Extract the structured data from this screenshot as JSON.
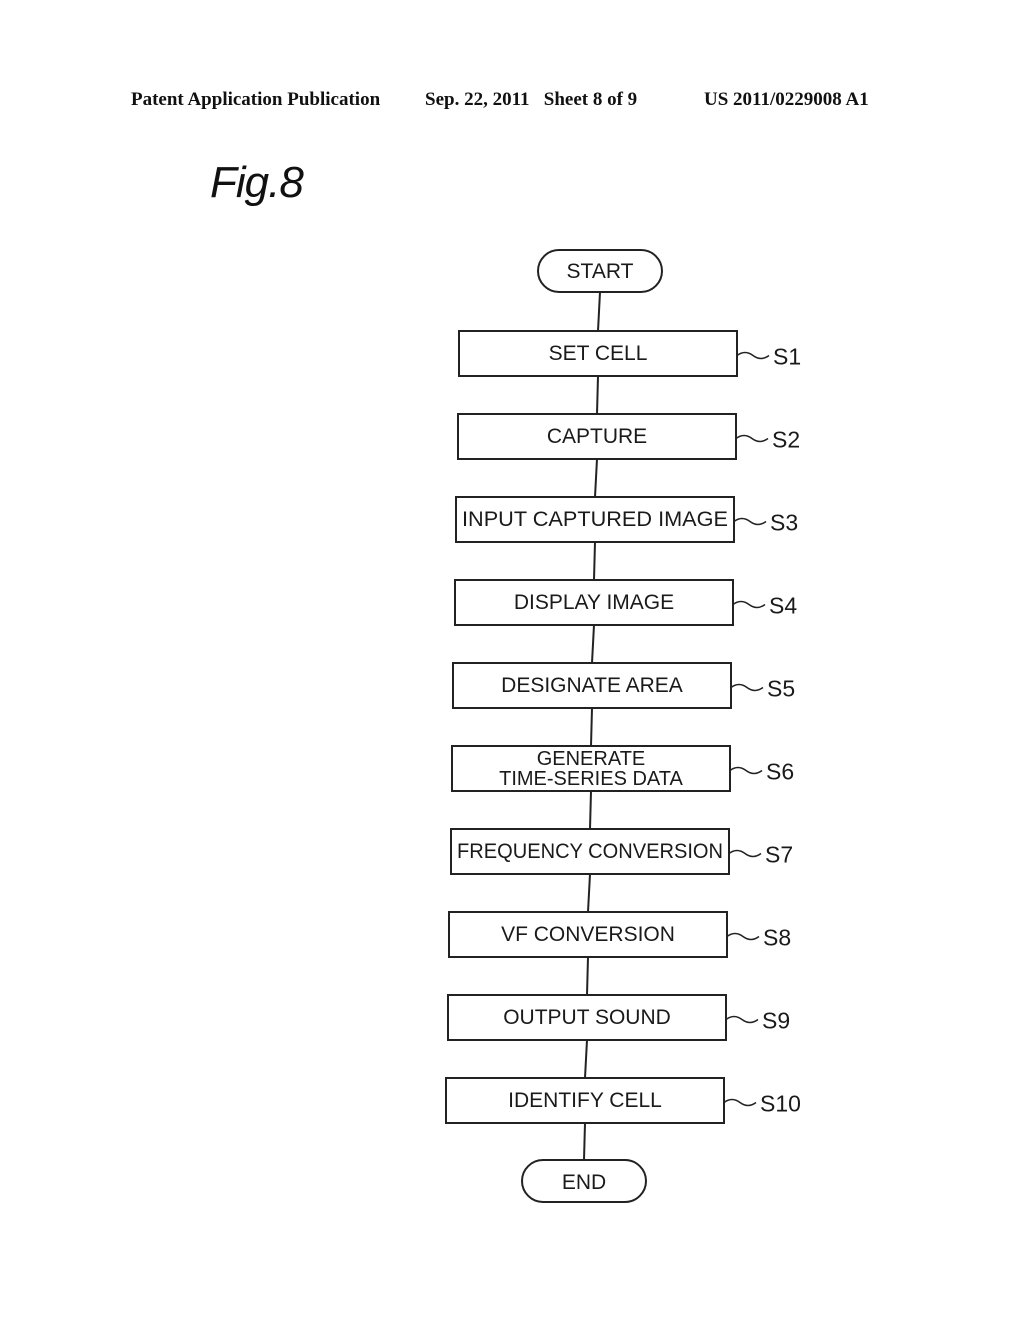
{
  "header": {
    "publication": "Patent Application Publication",
    "date_sheet": "Sep. 22, 2011   Sheet 8 of 9",
    "number": "US 2011/0229008 A1"
  },
  "figure": {
    "title": "Fig.8"
  },
  "flowchart": {
    "start": "START",
    "end": "END",
    "steps": [
      {
        "id": "S1",
        "lines": [
          "SET CELL"
        ]
      },
      {
        "id": "S2",
        "lines": [
          "CAPTURE"
        ]
      },
      {
        "id": "S3",
        "lines": [
          "INPUT CAPTURED IMAGE"
        ]
      },
      {
        "id": "S4",
        "lines": [
          "DISPLAY IMAGE"
        ]
      },
      {
        "id": "S5",
        "lines": [
          "DESIGNATE AREA"
        ]
      },
      {
        "id": "S6",
        "lines": [
          "GENERATE",
          "TIME-SERIES DATA"
        ]
      },
      {
        "id": "S7",
        "lines": [
          "FREQUENCY CONVERSION"
        ]
      },
      {
        "id": "S8",
        "lines": [
          "VF CONVERSION"
        ]
      },
      {
        "id": "S9",
        "lines": [
          "OUTPUT SOUND"
        ]
      },
      {
        "id": "S10",
        "lines": [
          "IDENTIFY CELL"
        ]
      }
    ]
  }
}
